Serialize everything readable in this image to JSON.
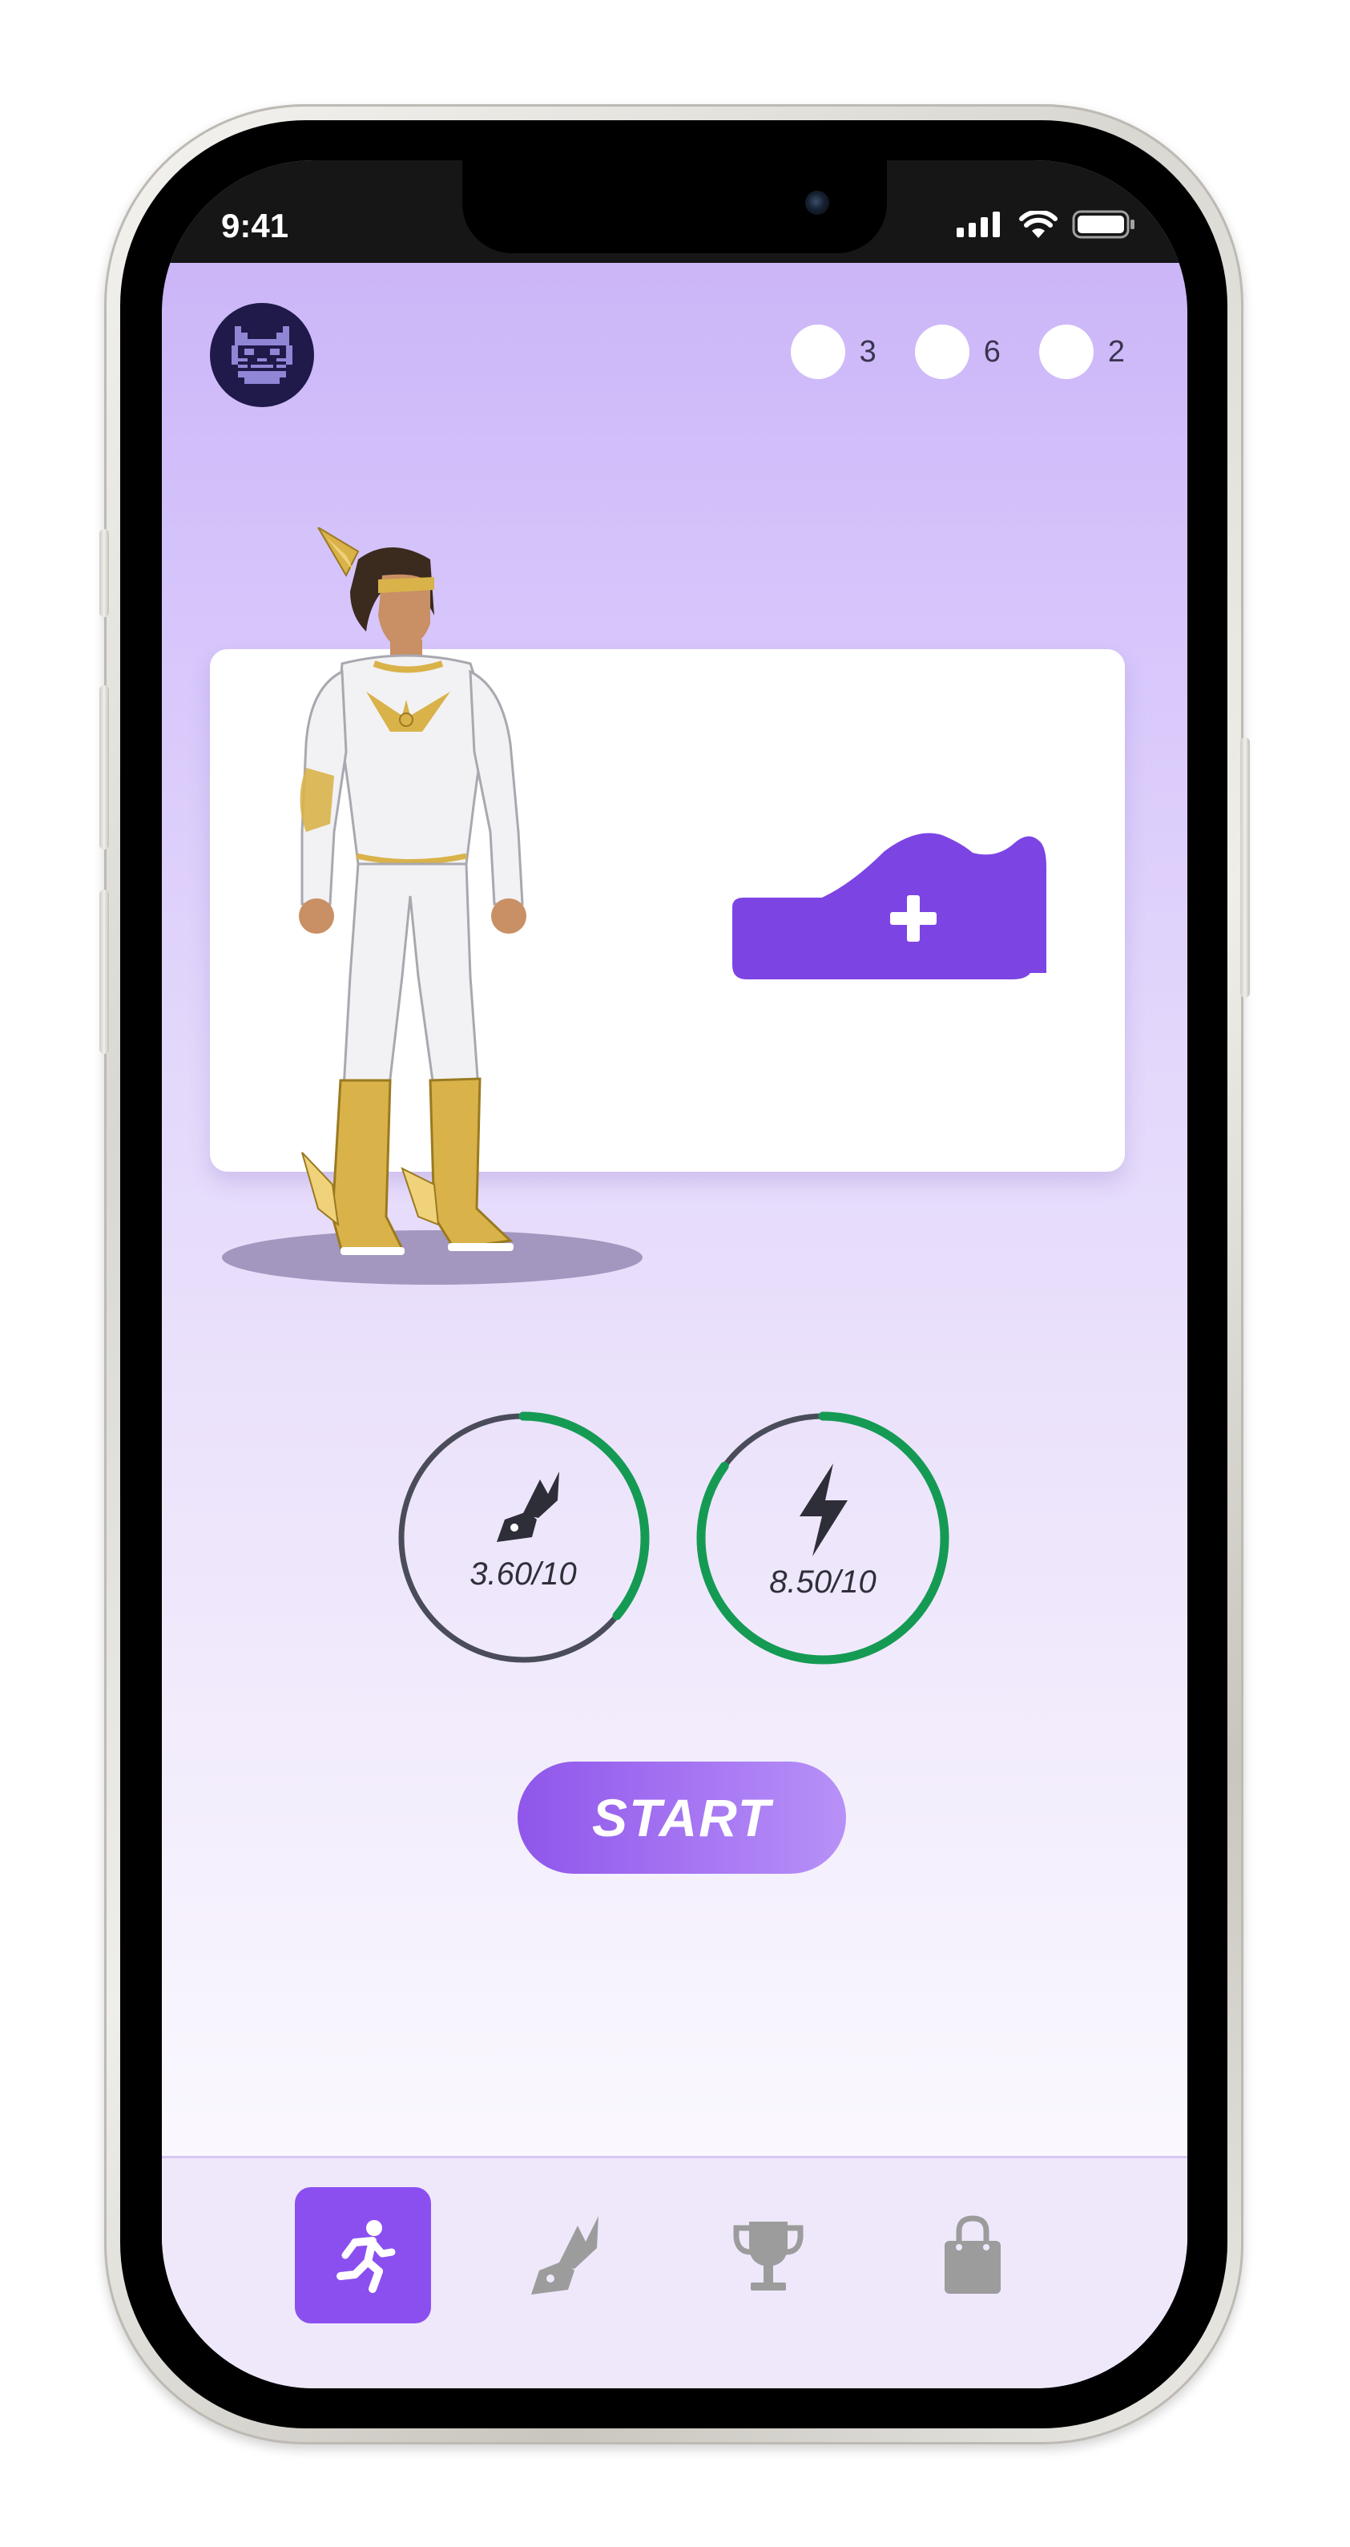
{
  "status_bar": {
    "time": "9:41",
    "icons": [
      "cellular-signal-icon",
      "wifi-icon",
      "battery-icon"
    ]
  },
  "header": {
    "avatar_icon": "pixel-cat-icon",
    "counters": [
      {
        "icon": "token-dot-icon",
        "value": "3"
      },
      {
        "icon": "token-dot-icon",
        "value": "6"
      },
      {
        "icon": "token-dot-icon",
        "value": "2"
      }
    ]
  },
  "hero_card": {
    "character": "winged-hero-character",
    "add_shoe_icon": "add-shoe-icon"
  },
  "stats": [
    {
      "icon": "winged-shoe-icon",
      "label": "3.60/10",
      "value": 3.6,
      "max": 10
    },
    {
      "icon": "lightning-bolt-icon",
      "label": "8.50/10",
      "value": 8.5,
      "max": 10
    }
  ],
  "start_button": {
    "label": "START"
  },
  "bottom_nav": {
    "items": [
      {
        "icon": "running-person-icon",
        "active": true
      },
      {
        "icon": "winged-shoe-icon",
        "active": false
      },
      {
        "icon": "trophy-icon",
        "active": false
      },
      {
        "icon": "shopping-bag-icon",
        "active": false
      }
    ]
  },
  "colors": {
    "accent": "#8b4ff0",
    "shoe_button": "#7d44e4",
    "ring_progress": "#159a54",
    "ring_track": "#4a4c5a",
    "avatar_bg": "#1f1a4a",
    "nav_inactive": "#9c9c9c"
  }
}
